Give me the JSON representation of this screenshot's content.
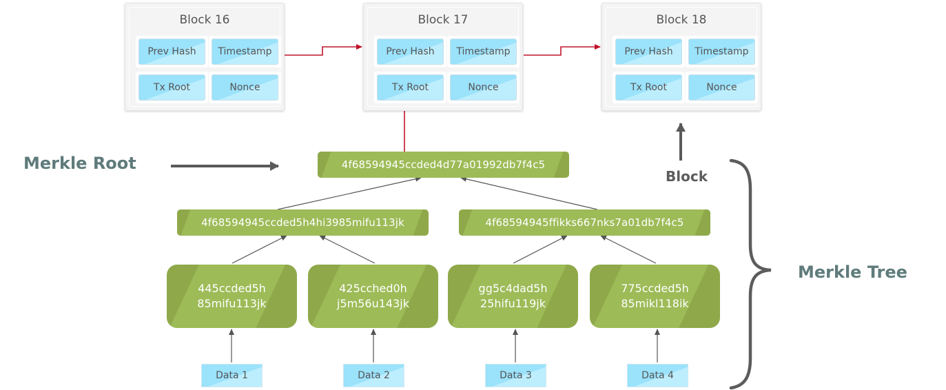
{
  "colors": {
    "chain_arrow": "#c0142a",
    "tree_arrow": "#5a5a5a",
    "hash_green": "#9dbb57",
    "hash_green_dark": "#8fa94a",
    "field_blue": "#9be2fb",
    "label_teal": "#5f7b7b"
  },
  "blocks": [
    {
      "title": "Block 16",
      "fields": [
        "Prev Hash",
        "Timestamp",
        "Tx Root",
        "Nonce"
      ]
    },
    {
      "title": "Block 17",
      "fields": [
        "Prev Hash",
        "Timestamp",
        "Tx Root",
        "Nonce"
      ]
    },
    {
      "title": "Block 18",
      "fields": [
        "Prev Hash",
        "Timestamp",
        "Tx Root",
        "Nonce"
      ]
    }
  ],
  "merkle_root": {
    "hash": "4f68594945ccded4d77a01992db7f4c5"
  },
  "intermediate_hashes": [
    {
      "hash": "4f68594945ccded5h4hi3985mifu113jk"
    },
    {
      "hash": "4f68594945ffikks667nks7a01db7f4c5"
    }
  ],
  "leaf_hashes": [
    {
      "line1": "445ccded5h",
      "line2": "85mifu113jk"
    },
    {
      "line1": "425cched0h",
      "line2": "j5m56u143jk"
    },
    {
      "line1": "gg5c4dad5h",
      "line2": "25hifu119jk"
    },
    {
      "line1": "775ccded5h",
      "line2": "85mikl118ik"
    }
  ],
  "data_items": [
    {
      "label": "Data 1"
    },
    {
      "label": "Data 2"
    },
    {
      "label": "Data 3"
    },
    {
      "label": "Data 4"
    }
  ],
  "labels": {
    "merkle_root": "Merkle Root",
    "block": "Block",
    "merkle_tree": "Merkle Tree"
  }
}
